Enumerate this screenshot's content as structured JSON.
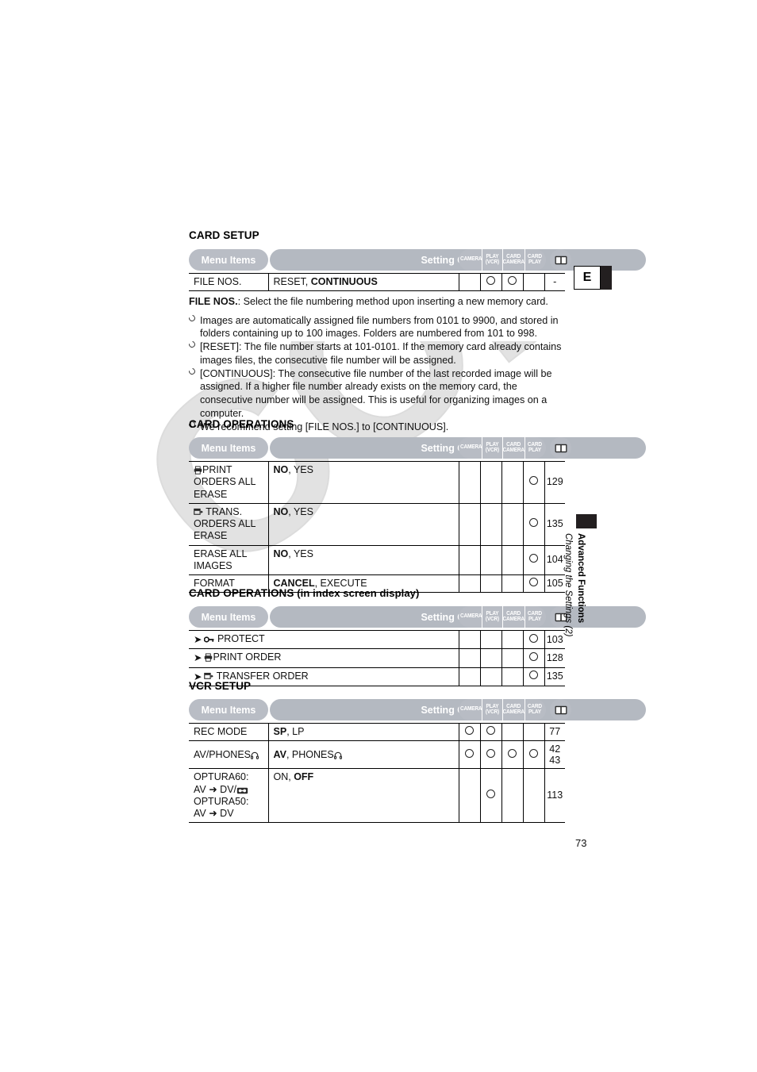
{
  "page": {
    "number": "73",
    "edge_tab_letter": "E",
    "side_label_bold": "Advanced Functions",
    "side_label_italic": "Changing the Settings (2)",
    "watermark": "COPY"
  },
  "table_header": {
    "menu_items": "Menu Items",
    "setting_options": "Setting Options",
    "modes": [
      {
        "line1": "CAMERA",
        "line2": ""
      },
      {
        "line1": "PLAY",
        "line2": "(VCR)"
      },
      {
        "line1": "CARD",
        "line2": "CAMERA"
      },
      {
        "line1": "CARD",
        "line2": "PLAY"
      }
    ],
    "reference_icon": "open-book-icon"
  },
  "sections": [
    {
      "id": "card-setup",
      "title": "CARD SETUP",
      "rows": [
        {
          "menu_item": "FILE NOS.",
          "options_plain": "RESET, ",
          "options_bold": "CONTINUOUS",
          "marks": [
            false,
            true,
            true,
            false
          ],
          "page_ref": "-"
        }
      ]
    },
    {
      "id": "card-operations",
      "title": "CARD OPERATIONS",
      "rows": [
        {
          "icon": "printer-icon",
          "menu_item": "PRINT ORDERS ALL ERASE",
          "options_bold": "NO",
          "options_plain": ", YES",
          "marks": [
            false,
            false,
            false,
            true
          ],
          "page_ref": "129"
        },
        {
          "icon": "transfer-icon",
          "menu_item": "TRANS. ORDERS ALL ERASE",
          "options_bold": "NO",
          "options_plain": ", YES",
          "marks": [
            false,
            false,
            false,
            true
          ],
          "page_ref": "135"
        },
        {
          "menu_item": "ERASE ALL IMAGES",
          "options_bold": "NO",
          "options_plain": ", YES",
          "marks": [
            false,
            false,
            false,
            true
          ],
          "page_ref": "104"
        },
        {
          "menu_item": "FORMAT",
          "options_bold": "CANCEL",
          "options_plain": ", EXECUTE",
          "marks": [
            false,
            false,
            false,
            true
          ],
          "page_ref": "105"
        }
      ]
    },
    {
      "id": "card-operations-index",
      "title": "CARD OPERATIONS",
      "title_suffix": " (in index screen display)",
      "rows": [
        {
          "arrow": true,
          "icon": "key-icon",
          "menu_item": "PROTECT",
          "marks": [
            false,
            false,
            false,
            true
          ],
          "page_ref": "103"
        },
        {
          "arrow": true,
          "icon": "printer-icon",
          "menu_item": "PRINT ORDER",
          "marks": [
            false,
            false,
            false,
            true
          ],
          "page_ref": "128"
        },
        {
          "arrow": true,
          "icon": "transfer-icon",
          "menu_item": "TRANSFER ORDER",
          "marks": [
            false,
            false,
            false,
            true
          ],
          "page_ref": "135"
        }
      ]
    },
    {
      "id": "vcr-setup",
      "title": "VCR SETUP",
      "rows": [
        {
          "menu_item": "REC MODE",
          "options_bold": "SP",
          "options_plain": ", LP",
          "marks": [
            true,
            true,
            false,
            false
          ],
          "page_ref": "77"
        },
        {
          "menu_item": "AV/PHONES",
          "menu_item_icon": "headphones-icon",
          "options_bold": "AV",
          "options_plain": ", PHONES",
          "options_icon": "headphones-icon",
          "marks": [
            true,
            true,
            true,
            true
          ],
          "page_ref": "42\n43"
        },
        {
          "menu_item_lines": [
            "OPTURA60:",
            "AV ➜ DV/",
            "OPTURA50:",
            "AV ➜ DV"
          ],
          "menu_item_icon": "cassette-icon",
          "options_plain": "ON, ",
          "options_bold": "OFF",
          "marks": [
            false,
            true,
            false,
            false
          ],
          "page_ref": "113"
        }
      ]
    }
  ],
  "body": {
    "file_nos_lead_bold": "FILE NOS.",
    "file_nos_lead_rest": ": Select the file numbering method upon inserting a new memory card.",
    "bullets": [
      "Images are automatically assigned file numbers from 0101 to 9900, and stored in folders containing up to 100 images. Folders are numbered from 101 to 998.",
      "[RESET]: The file number starts at 101-0101. If the memory card already contains images files, the consecutive file number will be assigned.",
      "[CONTINUOUS]: The consecutive file number of the last recorded image will be assigned. If a higher file number already exists on the memory card, the consecutive number will be assigned. This is useful for organizing images on a computer.",
      "We recommend setting [FILE NOS.] to [CONTINUOUS]."
    ]
  }
}
